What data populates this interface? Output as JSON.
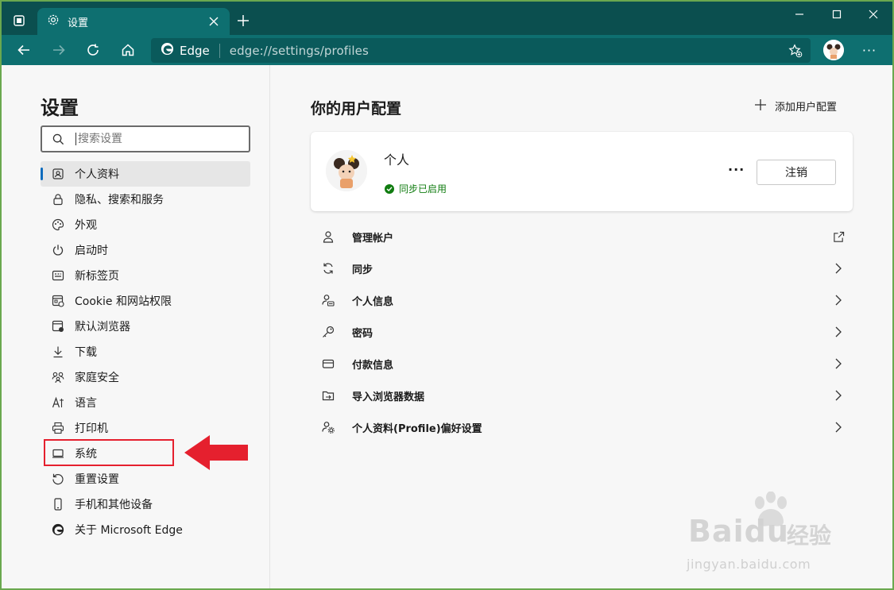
{
  "browser": {
    "tab_title": "设置",
    "address_label": "Edge",
    "url": "edge://settings/profiles"
  },
  "sidebar": {
    "title": "设置",
    "search_placeholder": "搜索设置",
    "items": [
      {
        "label": "个人资料",
        "icon": "profile-icon",
        "active": true
      },
      {
        "label": "隐私、搜索和服务",
        "icon": "lock-icon"
      },
      {
        "label": "外观",
        "icon": "palette-icon"
      },
      {
        "label": "启动时",
        "icon": "power-icon"
      },
      {
        "label": "新标签页",
        "icon": "newtab-icon"
      },
      {
        "label": "Cookie 和网站权限",
        "icon": "site-permissions-icon"
      },
      {
        "label": "默认浏览器",
        "icon": "default-browser-icon"
      },
      {
        "label": "下载",
        "icon": "download-icon"
      },
      {
        "label": "家庭安全",
        "icon": "family-icon"
      },
      {
        "label": "语言",
        "icon": "language-icon"
      },
      {
        "label": "打印机",
        "icon": "printer-icon"
      },
      {
        "label": "系统",
        "icon": "system-icon"
      },
      {
        "label": "重置设置",
        "icon": "reset-icon"
      },
      {
        "label": "手机和其他设备",
        "icon": "phone-icon"
      },
      {
        "label": "关于 Microsoft Edge",
        "icon": "edge-logo-icon"
      }
    ]
  },
  "main": {
    "title": "你的用户配置",
    "add_profile_label": "添加用户配置",
    "profile": {
      "name": "个人",
      "sync_status": "同步已启用",
      "more_label": "···",
      "sign_out_label": "注销"
    },
    "rows": [
      {
        "label": "管理帐户",
        "icon": "person-icon",
        "end": "external-link-icon"
      },
      {
        "label": "同步",
        "icon": "sync-icon",
        "end": "chevron-right-icon"
      },
      {
        "label": "个人信息",
        "icon": "personal-info-icon",
        "end": "chevron-right-icon"
      },
      {
        "label": "密码",
        "icon": "key-icon",
        "end": "chevron-right-icon"
      },
      {
        "label": "付款信息",
        "icon": "card-icon",
        "end": "chevron-right-icon"
      },
      {
        "label": "导入浏览器数据",
        "icon": "import-icon",
        "end": "chevron-right-icon"
      },
      {
        "label": "个人资料(Profile)偏好设置",
        "icon": "profile-prefs-icon",
        "end": "chevron-right-icon"
      }
    ]
  },
  "annotation": {
    "highlighted_item": "系统",
    "color": "#e5202e"
  },
  "watermark": {
    "logo": "Baidu",
    "chinese": "经验",
    "url": "jingyan.baidu.com"
  },
  "colors": {
    "titlebar": "#0b4f4f",
    "toolbar": "#0e6f70",
    "accent": "#0f6cbd",
    "sync_green": "#107c10"
  }
}
